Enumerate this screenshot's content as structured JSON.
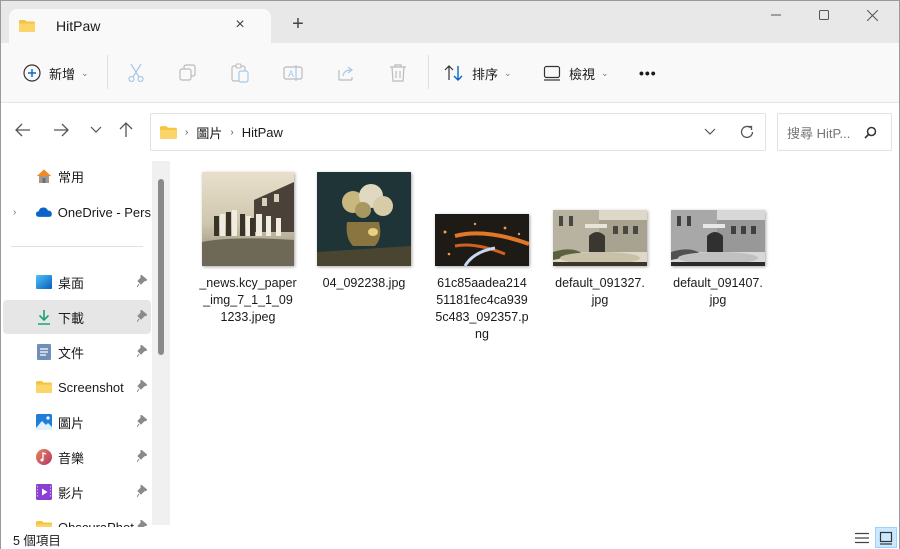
{
  "window": {
    "tab_title": "HitPaw",
    "tab_close_icon": "×",
    "new_tab_icon": "+",
    "minimize": "—",
    "maximize": "☐",
    "close": "✕"
  },
  "toolbar": {
    "new_label": "新增",
    "sort_label": "排序",
    "view_label": "檢視",
    "more_label": "•••"
  },
  "nav": {
    "breadcrumb": [
      "圖片",
      "HitPaw"
    ],
    "search_placeholder": "搜尋 HitP..."
  },
  "sidebar": {
    "items": [
      {
        "label": "常用",
        "icon": "home-icon"
      },
      {
        "label": "OneDrive - Pers",
        "icon": "onedrive-icon"
      },
      {
        "label": "桌面",
        "icon": "desktop-icon",
        "pinned": true
      },
      {
        "label": "下載",
        "icon": "download-icon",
        "pinned": true,
        "selected": true
      },
      {
        "label": "文件",
        "icon": "documents-icon",
        "pinned": true
      },
      {
        "label": "Screenshot",
        "icon": "folder-icon",
        "pinned": true
      },
      {
        "label": "圖片",
        "icon": "pictures-icon",
        "pinned": true
      },
      {
        "label": "音樂",
        "icon": "music-icon",
        "pinned": true
      },
      {
        "label": "影片",
        "icon": "videos-icon",
        "pinned": true
      },
      {
        "label": "ObscuraPhot",
        "icon": "folder-icon",
        "pinned": true
      }
    ]
  },
  "files": [
    {
      "name": "_news.kcy_paper_img_7_1_1_091233.jpeg",
      "display": [
        "_news.kcy_paper",
        "_img_7_1_1_09",
        "1233.jpeg"
      ]
    },
    {
      "name": "04_092238.jpg",
      "display": [
        "04_092238.jpg"
      ]
    },
    {
      "name": "61c85aadea21451181fec4ca9395c483_092357.png",
      "display": [
        "61c85aadea214",
        "51181fec4ca939",
        "5c483_092357.p",
        "ng"
      ]
    },
    {
      "name": "default_091327.jpg",
      "display": [
        "default_091327.",
        "jpg"
      ]
    },
    {
      "name": "default_091407.jpg",
      "display": [
        "default_091407.",
        "jpg"
      ]
    }
  ],
  "status": {
    "item_count": "5 個項目"
  }
}
